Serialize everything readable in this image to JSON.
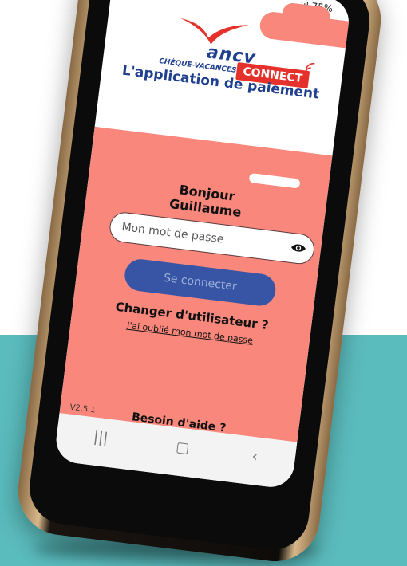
{
  "status": {
    "battery": "75%"
  },
  "brand": {
    "name": "ancv",
    "subtitle": "CHÈQUE-VACANCES",
    "product": "CONNECT",
    "tagline": "L'application de paiement",
    "colors": {
      "red": "#e4312b",
      "blue": "#1f3f8f",
      "salmon": "#f9877c",
      "teal": "#5bbcbd"
    }
  },
  "greeting": {
    "line1": "Bonjour",
    "line2": "Guillaume"
  },
  "password": {
    "placeholder": "Mon mot de passe",
    "value": ""
  },
  "login_button": "Se connecter",
  "change_user": "Changer d'utilisateur ?",
  "forgot_password": "J'ai oublié mon mot de passe",
  "version": "V2.5.1",
  "help": "Besoin d'aide ?",
  "navbar": {
    "recent": "|||",
    "home": "▢",
    "back": "‹"
  },
  "icons": [
    "bird-logo-icon",
    "wifi-signal-icon",
    "eye-icon"
  ]
}
